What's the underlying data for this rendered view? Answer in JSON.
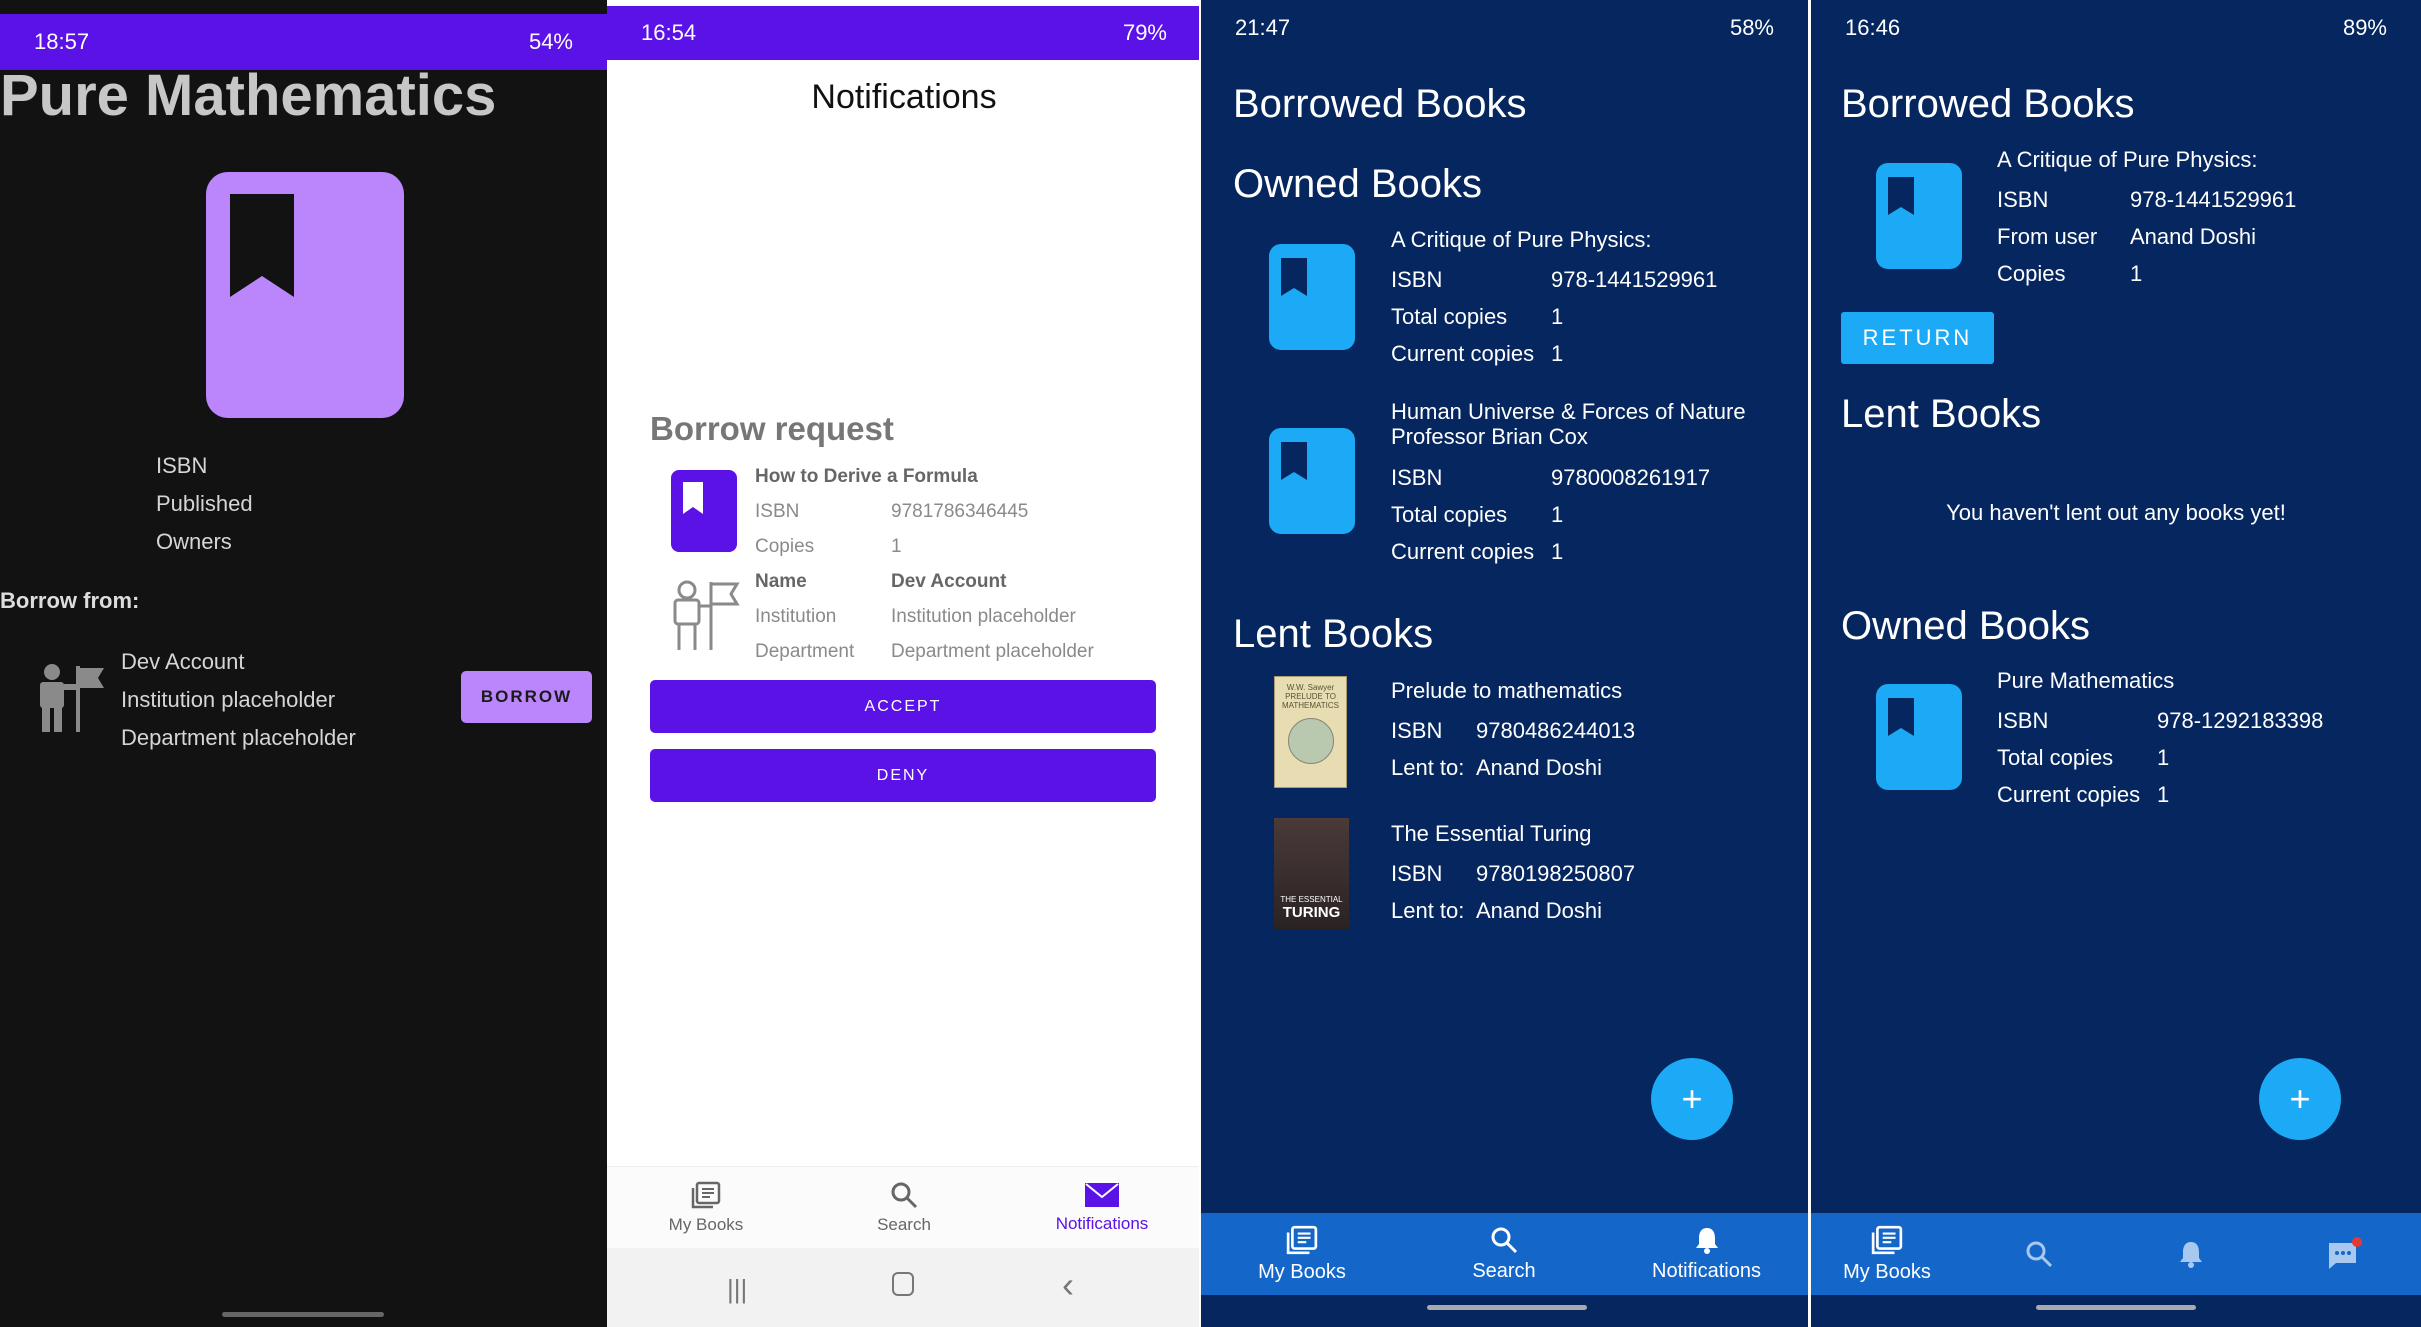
{
  "p1": {
    "status_time": "18:57",
    "status_right": "54%",
    "title": "Pure Mathematics",
    "labels": [
      "ISBN",
      "Published",
      "Owners"
    ],
    "borrow_from": "Borrow from:",
    "owner_name": "Dev Account",
    "owner_institution": "Institution placeholder",
    "owner_department": "Department placeholder",
    "borrow_button": "BORROW",
    "accent": "#bb86fc"
  },
  "p2": {
    "status_time": "16:54",
    "status_right": "79%",
    "title": "Notifications",
    "section": "Borrow request",
    "book_title": "How to Derive a Formula",
    "isbn_label": "ISBN",
    "isbn_value": "9781786346445",
    "copies_label": "Copies",
    "copies_value": "1",
    "name_label": "Name",
    "name_value": "Dev Account",
    "institution_label": "Institution",
    "institution_value": "Institution placeholder",
    "department_label": "Department",
    "department_value": "Department placeholder",
    "accept": "ACCEPT",
    "deny": "DENY",
    "nav": [
      "My Books",
      "Search",
      "Notifications"
    ],
    "accent": "#5b12e6"
  },
  "p3": {
    "status_time": "21:47",
    "status_right": "58%",
    "borrowed": "Borrowed Books",
    "owned": "Owned Books",
    "owned_books": [
      {
        "title": "A Critique of Pure Physics:",
        "isbn": "978-1441529961",
        "total": "1",
        "current": "1"
      },
      {
        "title": "Human Universe & Forces of Nature Professor Brian Cox",
        "isbn": "9780008261917",
        "total": "1",
        "current": "1"
      }
    ],
    "isbn_label": "ISBN",
    "total_label": "Total copies",
    "current_label": "Current copies",
    "lent": "Lent Books",
    "lent_books": [
      {
        "title": "Prelude to mathematics",
        "isbn": "9780486244013",
        "lent_to": "Anand Doshi"
      },
      {
        "title": "The Essential Turing",
        "isbn": "9780198250807",
        "lent_to": "Anand Doshi"
      }
    ],
    "lent_to_label": "Lent to:",
    "cover1_lines": [
      "W.W. Sawyer",
      "PRELUDE TO",
      "MATHEMATICS"
    ],
    "cover2_lines": [
      "THE ESSENTIAL",
      "TURING"
    ],
    "fab": "+",
    "nav": [
      "My Books",
      "Search",
      "Notifications"
    ],
    "accent": "#1ca9f5"
  },
  "p4": {
    "status_time": "16:46",
    "status_right": "89%",
    "borrowed": "Borrowed Books",
    "borrowed_book": {
      "title": "A Critique of Pure Physics:",
      "isbn": "978-1441529961",
      "from_user": "Anand Doshi",
      "copies": "1"
    },
    "isbn_label": "ISBN",
    "from_label": "From user",
    "copies_label": "Copies",
    "return": "RETURN",
    "lent": "Lent Books",
    "empty": "You haven't lent out any books yet!",
    "owned": "Owned Books",
    "owned_book": {
      "title": "Pure Mathematics",
      "isbn": "978-1292183398",
      "total": "1",
      "current": "1"
    },
    "total_label": "Total copies",
    "current_label": "Current copies",
    "fab": "+",
    "nav": [
      "My Books"
    ]
  }
}
